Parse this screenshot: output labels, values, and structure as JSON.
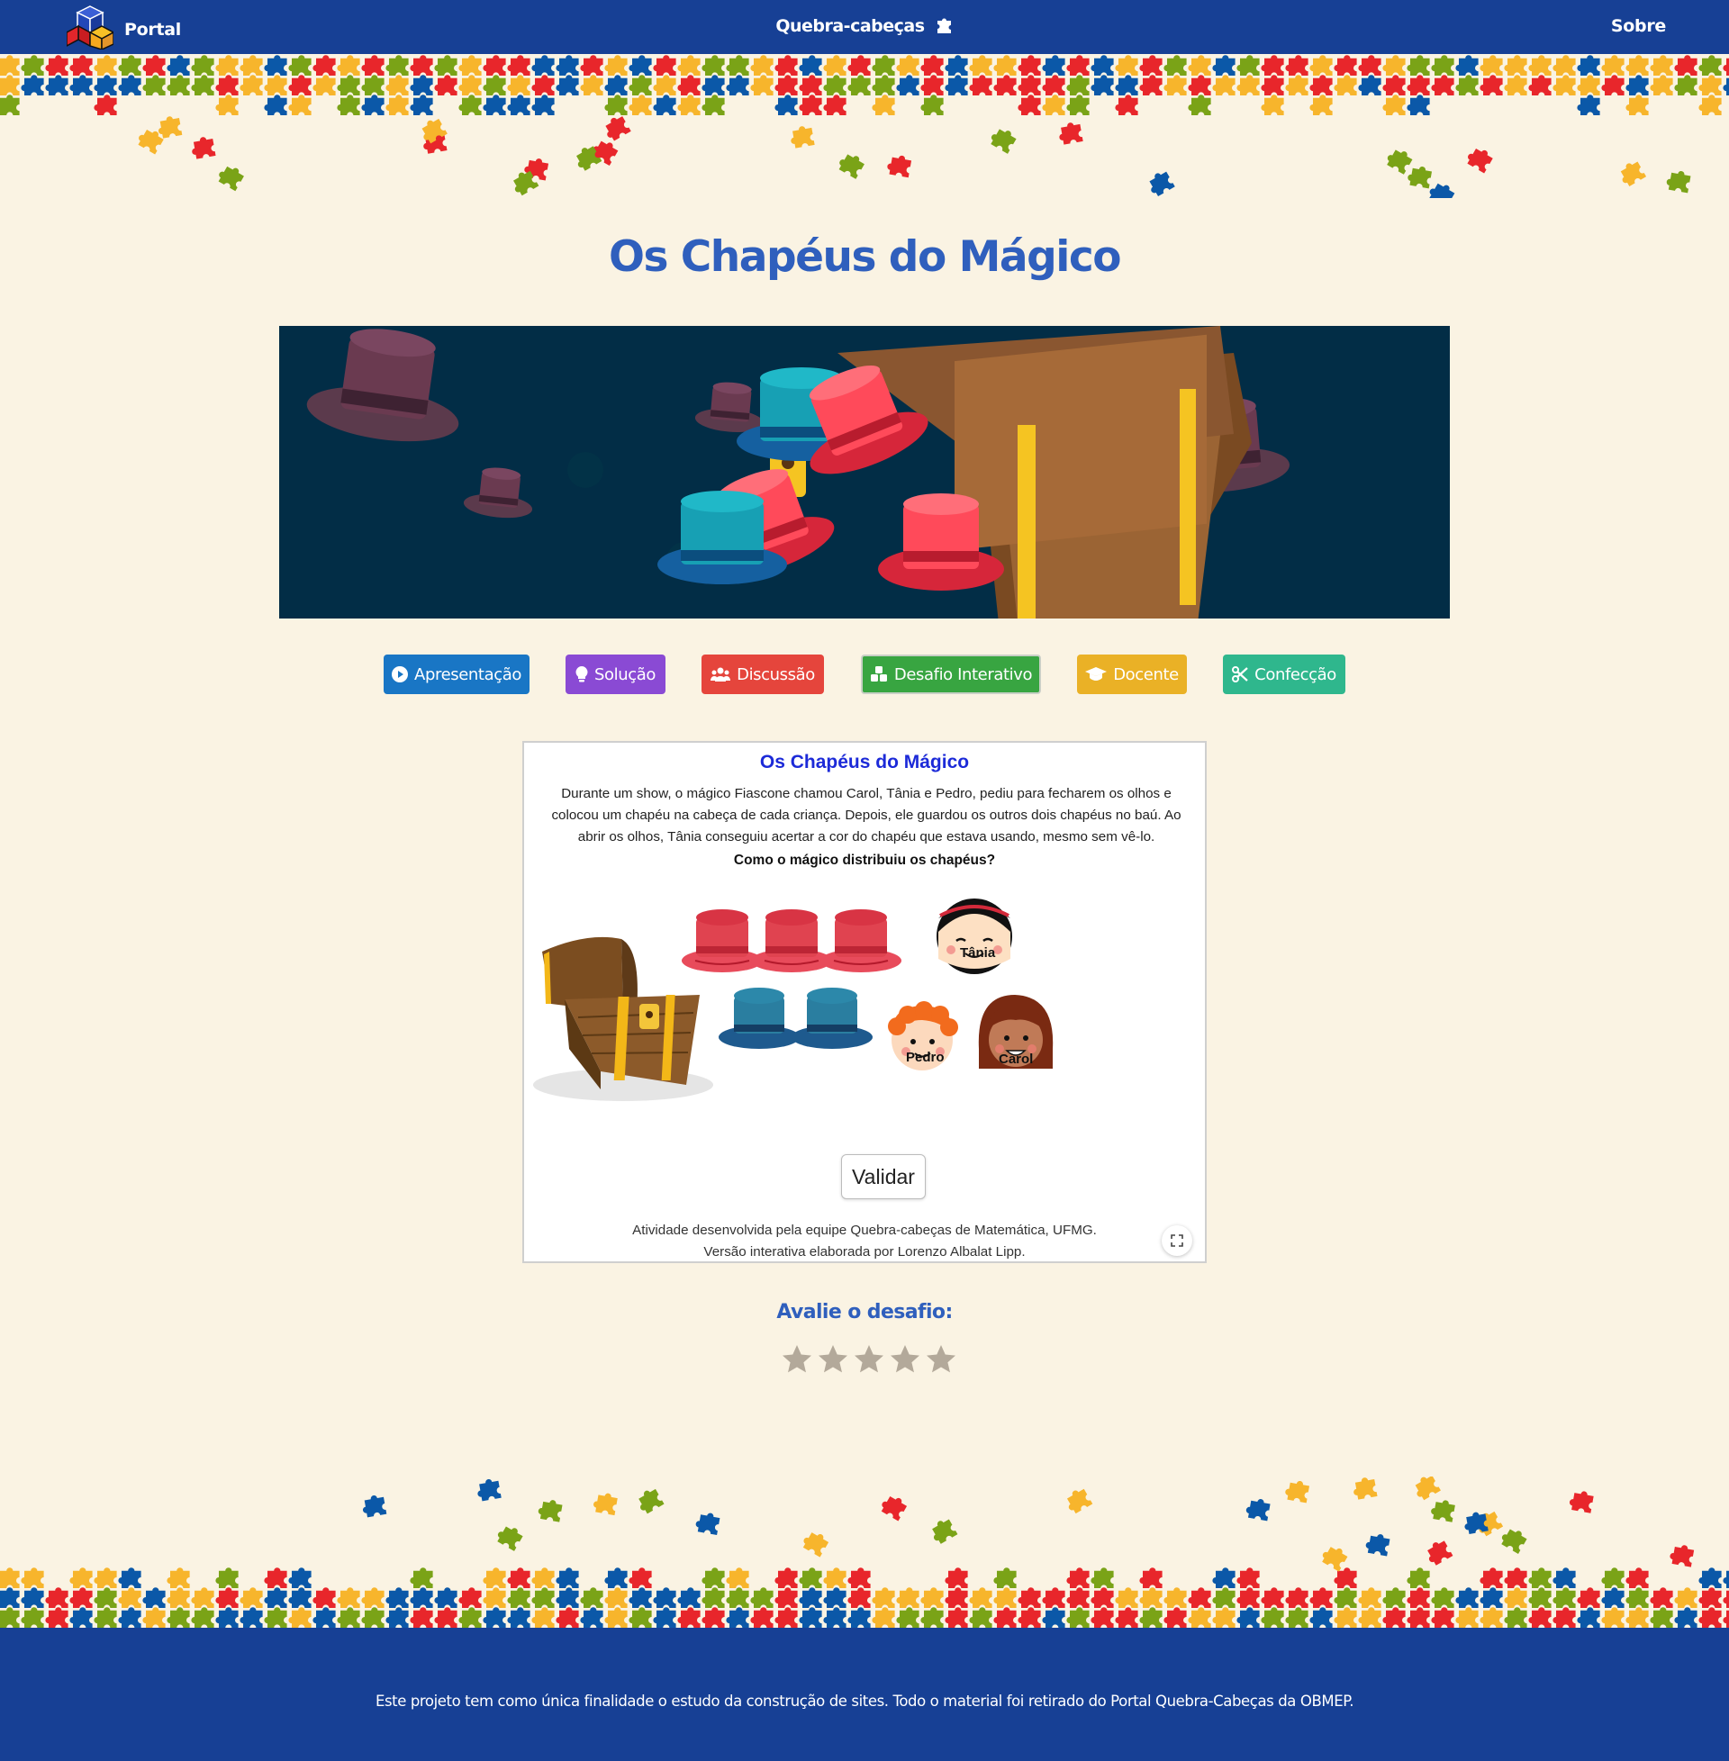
{
  "navbar": {
    "brand_label": "Portal",
    "center_label": "Quebra-cabeças",
    "right_label": "Sobre"
  },
  "page": {
    "title": "Os Chapéus do Mágico"
  },
  "tabs": [
    {
      "label": "Apresentação",
      "icon": "play-circle-icon",
      "color": "#1976c5"
    },
    {
      "label": "Solução",
      "icon": "lightbulb-icon",
      "color": "#8a4ad4"
    },
    {
      "label": "Discussão",
      "icon": "users-icon",
      "color": "#e5453c"
    },
    {
      "label": "Desafio Interativo",
      "icon": "cubes-icon",
      "color": "#38a541"
    },
    {
      "label": "Docente",
      "icon": "graduation-cap-icon",
      "color": "#eab126"
    },
    {
      "label": "Confecção",
      "icon": "scissors-icon",
      "color": "#2fb78d"
    }
  ],
  "activity": {
    "title": "Os Chapéus do Mágico",
    "description": "Durante um show, o mágico Fiascone chamou Carol, Tânia e Pedro, pediu para fecharem os olhos e colocou um chapéu na cabeça de cada criança. Depois, ele guardou os outros dois chapéus no baú. Ao abrir os olhos, Tânia conseguiu acertar a cor do chapéu que estava usando, mesmo sem vê-lo.",
    "question": "Como o mágico distribuiu os chapéus?",
    "children": [
      "Tânia",
      "Pedro",
      "Carol"
    ],
    "hats": {
      "red_count": 3,
      "blue_count": 2
    },
    "validate_label": "Validar",
    "credit_line1": "Atividade desenvolvida pela equipe Quebra-cabeças de Matemática, UFMG.",
    "credit_line2": "Versão interativa elaborada por Lorenzo Albalat Lipp."
  },
  "rating": {
    "label": "Avalie o desafio:",
    "max_stars": 5,
    "current_value": 0
  },
  "footer": {
    "text": "Este projeto tem como única finalidade o estudo da construção de sites. Todo o material foi retirado do Portal Quebra-Cabeças da OBMEP."
  },
  "colors": {
    "nav_background": "#174095",
    "page_background": "#faf3e3",
    "title_color": "#2f5fbd",
    "banner_background": "#022d46",
    "puzzle": [
      "#e8262b",
      "#f7b52c",
      "#7aa317",
      "#0b58a8"
    ]
  }
}
